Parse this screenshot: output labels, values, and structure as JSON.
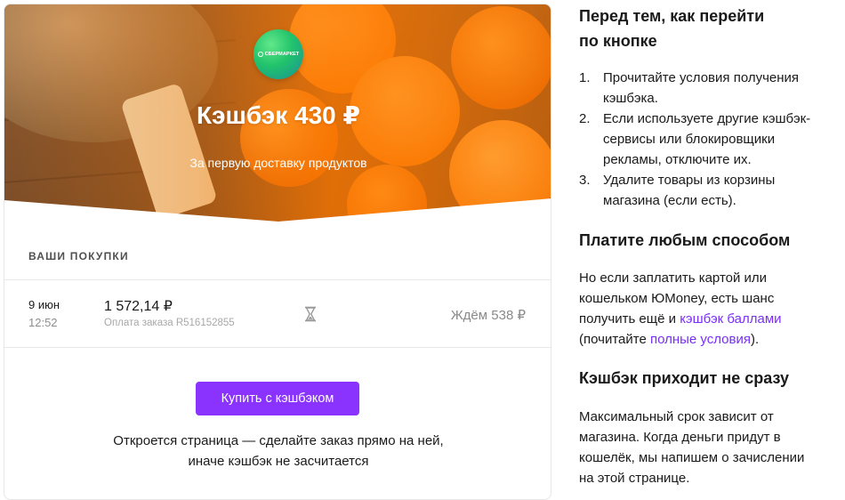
{
  "offer": {
    "store_logo_text": "СБЕРМАРКЕТ",
    "title": "Кэшбэк 430 ₽",
    "subtitle": "За первую доставку продуктов",
    "accent_color": "#ff8a1a",
    "brand_logo_color": "#21c36b"
  },
  "purchases": {
    "section_label": "ВАШИ ПОКУПКИ",
    "rows": [
      {
        "date": "9 июн",
        "time": "12:52",
        "amount": "1 572,14 ₽",
        "order": "Оплата заказа R516152855",
        "status_icon": "hourglass-icon",
        "status": "Ждём 538 ₽"
      }
    ]
  },
  "cta": {
    "button_label": "Купить с кэшбэком",
    "button_color": "#8a33ff",
    "note_line1": "Откроется страница — сделайте заказ прямо на ней,",
    "note_line2": "иначе кэшбэк не засчитается"
  },
  "info": {
    "heading1_line1": "Перед тем, как перейти",
    "heading1_line2": "по кнопке",
    "steps": [
      {
        "num": "1.",
        "line1": "Прочитайте условия получения",
        "line2": "кэшбэка."
      },
      {
        "num": "2.",
        "line1": "Если используете другие кэшбэк-",
        "line2": "сервисы или блокировщики",
        "line3": "рекламы, отключите их."
      },
      {
        "num": "3.",
        "line1": "Удалите товары из корзины",
        "line2": "магазина (если есть)."
      }
    ],
    "heading2": "Платите любым способом",
    "pay_line1": "Но если заплатить картой или",
    "pay_line2": "кошельком ЮMoney, есть шанс",
    "pay_line3_prefix": "получить ещё и ",
    "pay_link1": "кэшбэк баллами",
    "pay_line4_prefix": "(почитайте ",
    "pay_link2": "полные условия",
    "pay_line4_suffix": ").",
    "heading3": "Кэшбэк приходит не сразу",
    "delay_line1": "Максимальный срок зависит от",
    "delay_line2": "магазина. Когда деньги придут в",
    "delay_line3": "кошелёк, мы напишем о зачислении",
    "delay_line4": "на этой странице.",
    "link_color": "#7a2ff7"
  }
}
